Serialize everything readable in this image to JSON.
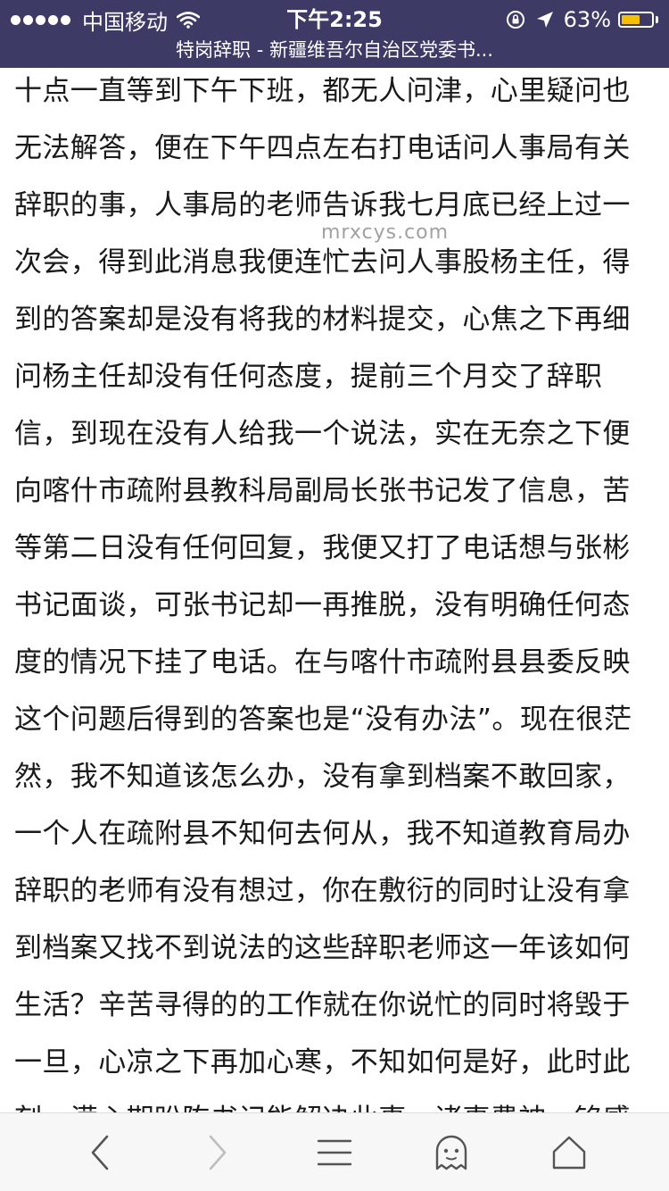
{
  "status_bar": {
    "carrier": "中国移动",
    "time": "下午2:25",
    "battery_percent": "63%",
    "battery_level": 0.63,
    "battery_color": "#f6c000",
    "icons": [
      "signal-dots",
      "wifi-icon",
      "rotation-lock-icon",
      "location-arrow-icon",
      "battery-icon"
    ]
  },
  "page": {
    "title": "特岗辞职 - 新疆维吾尔自治区党委书..."
  },
  "article": {
    "text": "十点一直等到下午下班，都无人问津，心里疑问也无法解答，便在下午四点左右打电话问人事局有关辞职的事，人事局的老师告诉我七月底已经上过一次会，得到此消息我便连忙去问人事股杨主任，得到的答案却是没有将我的材料提交，心焦之下再细问杨主任却没有任何态度，提前三个月交了辞职信，到现在没有人给我一个说法，实在无奈之下便向喀什市疏附县教科局副局长张书记发了信息，苦等第二日没有任何回复，我便又打了电话想与张彬书记面谈，可张书记却一再推脱，没有明确任何态度的情况下挂了电话。在与喀什市疏附县县委反映这个问题后得到的答案也是“没有办法”。现在很茫然，我不知道该怎么办，没有拿到档案不敢回家，一个人在疏附县不知何去何从，我不知道教育局办辞职的老师有没有想过，你在敷衍的同时让没有拿到档案又找不到说法的这些辞职老师这一年该如何生活？辛苦寻得的的工作就在你说忙的同时将毁于一旦，心凉之下再加心寒，不知如何是好，此时此刻，满心期盼陈书记能解决此事，诸事费神，铭感"
  },
  "watermark": "mrxcys.com",
  "toolbar": {
    "icons": [
      "back-icon",
      "forward-icon",
      "menu-icon",
      "ghost-icon",
      "home-icon"
    ]
  },
  "colors": {
    "status_bar_bg": "#3d3a66",
    "toolbar_bg": "#f7f7f7",
    "text": "#1a1a1a"
  }
}
